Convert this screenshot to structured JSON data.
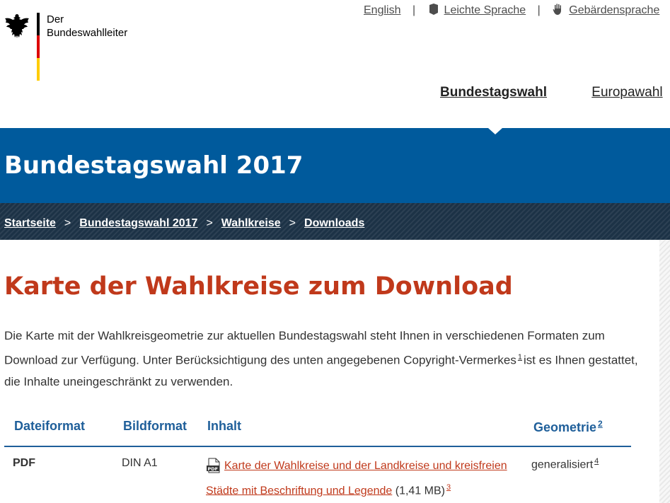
{
  "logo": {
    "line1": "Der",
    "line2": "Bundeswahlleiter"
  },
  "meta_nav": [
    {
      "label": "English",
      "icon": ""
    },
    {
      "label": "Leichte Sprache",
      "icon": "easy-language-icon"
    },
    {
      "label": "Gebärdensprache",
      "icon": "sign-language-icon"
    },
    {
      "label": "I",
      "icon": ""
    }
  ],
  "main_nav": [
    {
      "label": "Bundestagswahl",
      "active": true
    },
    {
      "label": "Europawahl",
      "active": false
    }
  ],
  "banner": {
    "title": "Bundestagswahl 2017"
  },
  "breadcrumb": [
    "Startseite",
    "Bundestagswahl 2017",
    "Wahlkreise",
    "Downloads"
  ],
  "page": {
    "title": "Karte der Wahlkreise zum Download",
    "intro_part1": "Die Karte mit der Wahlkreisgeometrie zur aktuellen Bundestagswahl steht Ihnen in verschiedenen Formaten zum Download zur Verfügung. Unter Berücksichtigung des unten angegebenen Copyright-Vermerkes",
    "intro_fn": "1",
    "intro_part2": "ist es Ihnen gestattet, die Inhalte uneingeschränkt zu verwenden."
  },
  "table": {
    "headers": {
      "format": "Dateiformat",
      "image_format": "Bildformat",
      "content": "Inhalt",
      "geometry": "Geometrie",
      "geometry_fn": "2"
    },
    "rows": [
      {
        "format": "PDF",
        "image_format": "DIN A1",
        "link_text": "Karte der Wahlkreise und der Landkreise und kreisfreien Städte mit Beschriftung und Legende",
        "size": "(1,41 MB)",
        "size_fn": "3",
        "geometry": "generalisiert",
        "geometry_fn": "4"
      }
    ]
  },
  "colors": {
    "banner": "#005a9c",
    "breadcrumb": "#1c3246",
    "title": "#c0391b",
    "table_header": "#1f5f9a"
  }
}
